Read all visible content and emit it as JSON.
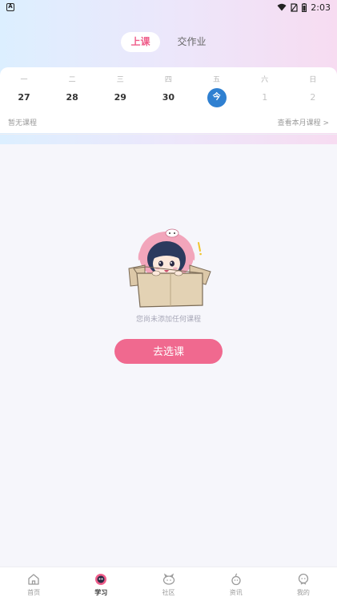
{
  "status_bar": {
    "notification_glyph": "A",
    "time": "2:03"
  },
  "header": {
    "tabs": [
      {
        "label": "上课",
        "active": true
      },
      {
        "label": "交作业",
        "active": false
      }
    ]
  },
  "calendar": {
    "weekdays": [
      "一",
      "二",
      "三",
      "四",
      "五",
      "六",
      "日"
    ],
    "dates": [
      {
        "label": "27",
        "state": "normal"
      },
      {
        "label": "28",
        "state": "normal"
      },
      {
        "label": "29",
        "state": "normal"
      },
      {
        "label": "30",
        "state": "normal"
      },
      {
        "label": "今",
        "state": "today"
      },
      {
        "label": "1",
        "state": "faded"
      },
      {
        "label": "2",
        "state": "faded"
      }
    ],
    "no_course_text": "暂无课程",
    "view_month_link": "查看本月课程 >"
  },
  "empty_state": {
    "message": "您尚未添加任何课程",
    "button_label": "去选课"
  },
  "bottom_nav": {
    "items": [
      {
        "label": "首页",
        "icon": "home-icon",
        "active": false
      },
      {
        "label": "学习",
        "icon": "study-icon",
        "active": true
      },
      {
        "label": "社区",
        "icon": "community-icon",
        "active": false
      },
      {
        "label": "资讯",
        "icon": "news-icon",
        "active": false
      },
      {
        "label": "我的",
        "icon": "profile-icon",
        "active": false
      }
    ]
  },
  "colors": {
    "accent_pink": "#f0698f",
    "today_blue": "#2f80d1"
  }
}
